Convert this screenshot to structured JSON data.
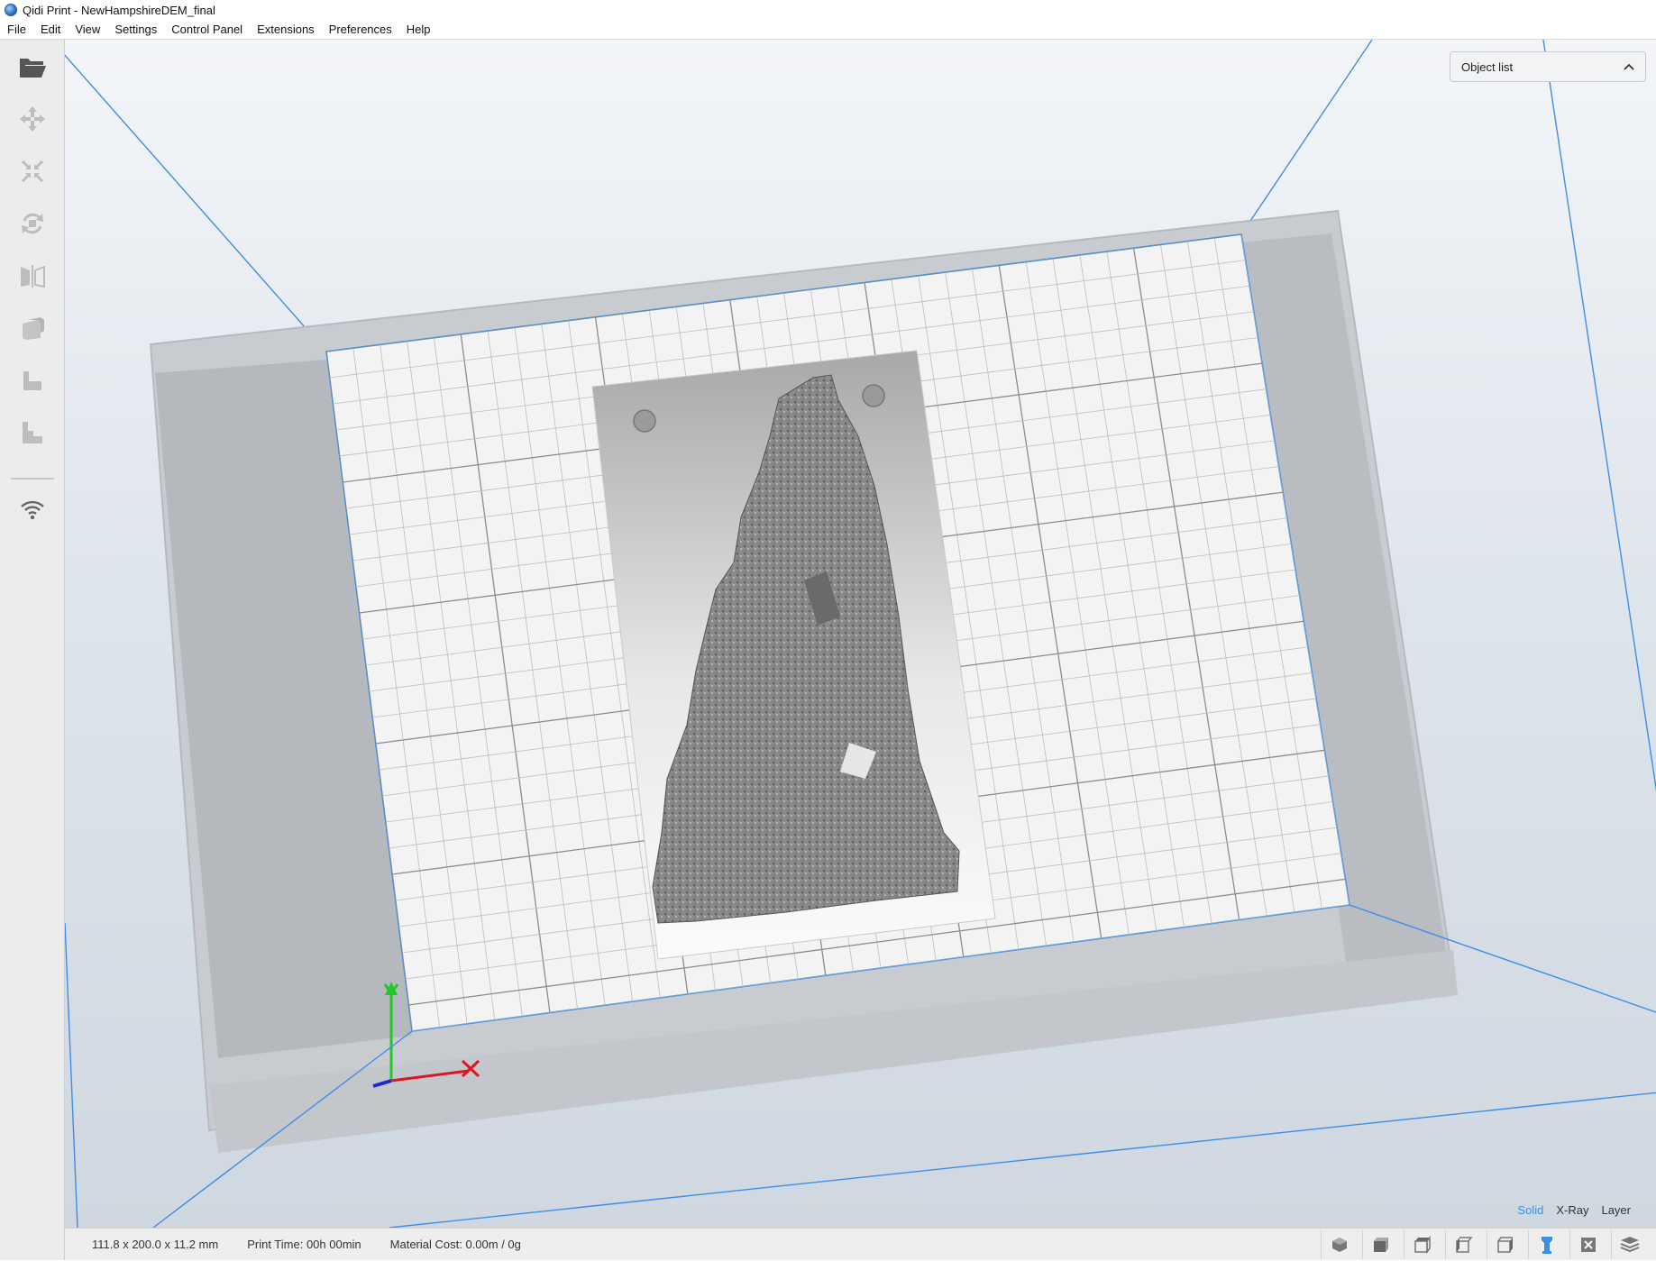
{
  "window": {
    "title": "Qidi Print - NewHampshireDEM_final"
  },
  "menu": [
    "File",
    "Edit",
    "View",
    "Settings",
    "Control Panel",
    "Extensions",
    "Preferences",
    "Help"
  ],
  "toolbar": {
    "tools": [
      "open-folder-icon",
      "move-icon",
      "scale-icon",
      "rotate-icon",
      "mirror-icon",
      "per-model-settings-icon",
      "support-blocker-icon",
      "layer-icon",
      "wifi-icon"
    ]
  },
  "object_list": {
    "label": "Object list"
  },
  "view_modes": {
    "solid": "Solid",
    "xray": "X-Ray",
    "layer": "Layer",
    "active": "Solid"
  },
  "status": {
    "dimensions": "111.8 x 200.0 x 11.2 mm",
    "print_time": "Print Time: 00h 00min",
    "material_cost": "Material Cost: 0.00m / 0g"
  },
  "colors": {
    "accent": "#3d8fe0",
    "axis_x": "#e0141e",
    "axis_y": "#22c82a",
    "axis_z": "#1a2ecf",
    "build_volume": "#3f8ee4"
  },
  "view_buttons": [
    "3d-view-icon",
    "front-view-icon",
    "top-view-icon",
    "left-view-icon",
    "right-view-icon",
    "solid-view-icon",
    "xray-view-icon",
    "layer-view-icon"
  ]
}
